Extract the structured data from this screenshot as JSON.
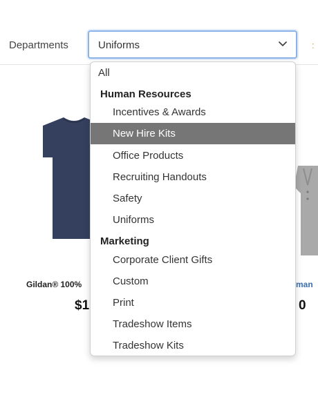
{
  "filter": {
    "label": "Departments",
    "selected": "Uniforms"
  },
  "products": [
    {
      "name": "Gildan® 100%",
      "price": "$1",
      "image": "navy-tshirt"
    },
    {
      "name": "man",
      "price": "0",
      "image": "gray-polo"
    }
  ],
  "dropdown": {
    "all_label": "All",
    "groups": [
      {
        "label": "Human Resources",
        "options": [
          "Incentives & Awards",
          "New Hire Kits",
          "Office Products",
          "Recruiting Handouts",
          "Safety",
          "Uniforms"
        ]
      },
      {
        "label": "Marketing",
        "options": [
          "Corporate Client Gifts",
          "Custom",
          "Print",
          "Tradeshow Items",
          "Tradeshow Kits"
        ]
      }
    ],
    "highlighted": "New Hire Kits"
  },
  "colors": {
    "highlight_bg": "#767676",
    "focus_border": "#8bb3e8",
    "shirt_navy": "#34405e",
    "link_blue": "#3a6fb0"
  }
}
